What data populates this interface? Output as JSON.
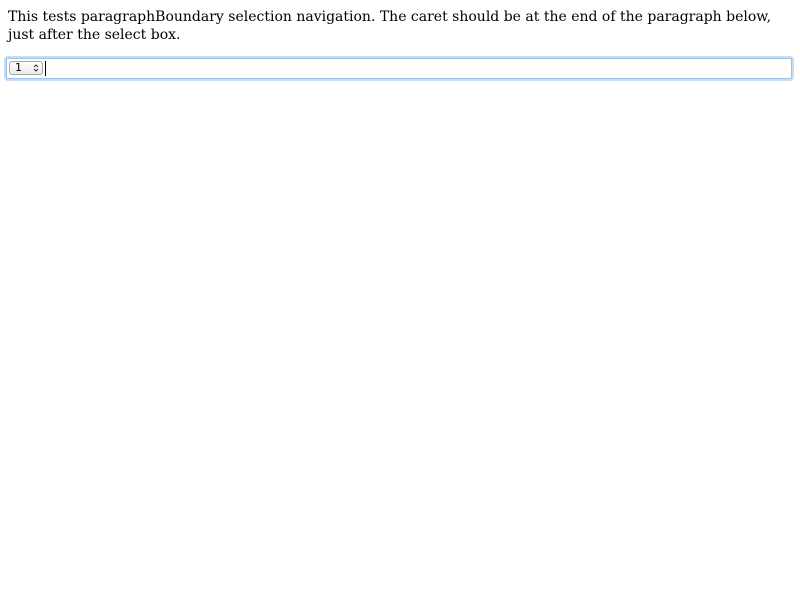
{
  "description": {
    "text": "This tests paragraphBoundary selection navigation. The caret should be at the end of the paragraph below, just after the select box."
  },
  "editor": {
    "select": {
      "selected_value": "1",
      "icon": "spinner-arrows-icon"
    }
  },
  "colors": {
    "focus_border": "#9ec2e4",
    "focus_glow": "#c9dcf0"
  }
}
